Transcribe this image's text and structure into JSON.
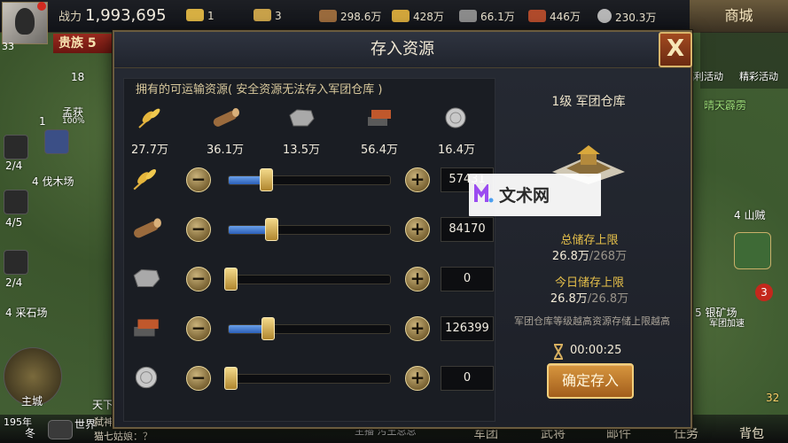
{
  "top": {
    "power_label": "战力",
    "power_value": "1,993,695",
    "level": "33",
    "nobility": "贵族 5",
    "resources": [
      {
        "icon": "gold-ingot-icon",
        "value": "1"
      },
      {
        "icon": "scroll-icon",
        "value": "3"
      },
      {
        "icon": "wood-log-icon",
        "value": "298.6万"
      },
      {
        "icon": "wheat-icon",
        "value": "428万"
      },
      {
        "icon": "stone-icon",
        "value": "66.1万"
      },
      {
        "icon": "iron-icon",
        "value": "446万"
      },
      {
        "icon": "silver-coin-icon",
        "value": "230.3万"
      }
    ],
    "shop": "商城"
  },
  "background_text": {
    "meng_huo": "孟获",
    "meng_huo_pct": "100%",
    "logging": "4 伐木场",
    "quarry": "4 采石场",
    "count_a": "2/4",
    "count_b": "4/5",
    "count_c": "2/4",
    "count_18": "18",
    "count_1": "1",
    "welfare": "福利活动",
    "events": "精彩活动",
    "weather": "晴天霹雳",
    "bandit": "4 山贼",
    "silver_mine": "5 银矿场",
    "legion_boost": "军团加速",
    "badge_3": "3",
    "badge_32": "32",
    "main_city": "主城",
    "year": "195年",
    "season": "冬",
    "world": "世界",
    "tianxia": "天下",
    "chat_line1": "弑神",
    "chat_line2": "猫七姑娘：？",
    "streamer": "主播  污王总总"
  },
  "bottom_nav": [
    "军团",
    "武将",
    "邮件",
    "任务",
    "背包"
  ],
  "modal": {
    "title": "存入资源",
    "close_label": "X",
    "section_title": "拥有的可运输资源",
    "section_note": "( 安全资源无法存入军团仓库 )",
    "owned": [
      {
        "icon": "wheat-icon",
        "value": "27.7万"
      },
      {
        "icon": "wood-log-icon",
        "value": "36.1万"
      },
      {
        "icon": "stone-icon",
        "value": "13.5万"
      },
      {
        "icon": "iron-icon",
        "value": "56.4万"
      },
      {
        "icon": "silver-coin-icon",
        "value": "16.4万"
      }
    ],
    "rows": [
      {
        "icon": "wheat-icon",
        "value": "57431",
        "fill": 0.22
      },
      {
        "icon": "wood-log-icon",
        "value": "84170",
        "fill": 0.25
      },
      {
        "icon": "stone-icon",
        "value": "0",
        "fill": 0.0
      },
      {
        "icon": "iron-icon",
        "value": "126399",
        "fill": 0.23
      },
      {
        "icon": "silver-coin-icon",
        "value": "0",
        "fill": 0.0
      }
    ],
    "depot_title": "1级 军团仓库",
    "total_cap_label": "总储存上限",
    "total_cap_used": "26.8万",
    "total_cap_max": "/268万",
    "today_cap_label": "今日储存上限",
    "today_cap_used": "26.8万",
    "today_cap_max": "/26.8万",
    "hint": "军团仓库等级越高资源存储上限越高",
    "timer": "00:00:25",
    "confirm": "确定存入"
  },
  "watermark": "文术网",
  "colors": {
    "accent_gold": "#e6c04a",
    "slider_blue": "#2b5fb8",
    "button_orange": "#c07a2c"
  }
}
